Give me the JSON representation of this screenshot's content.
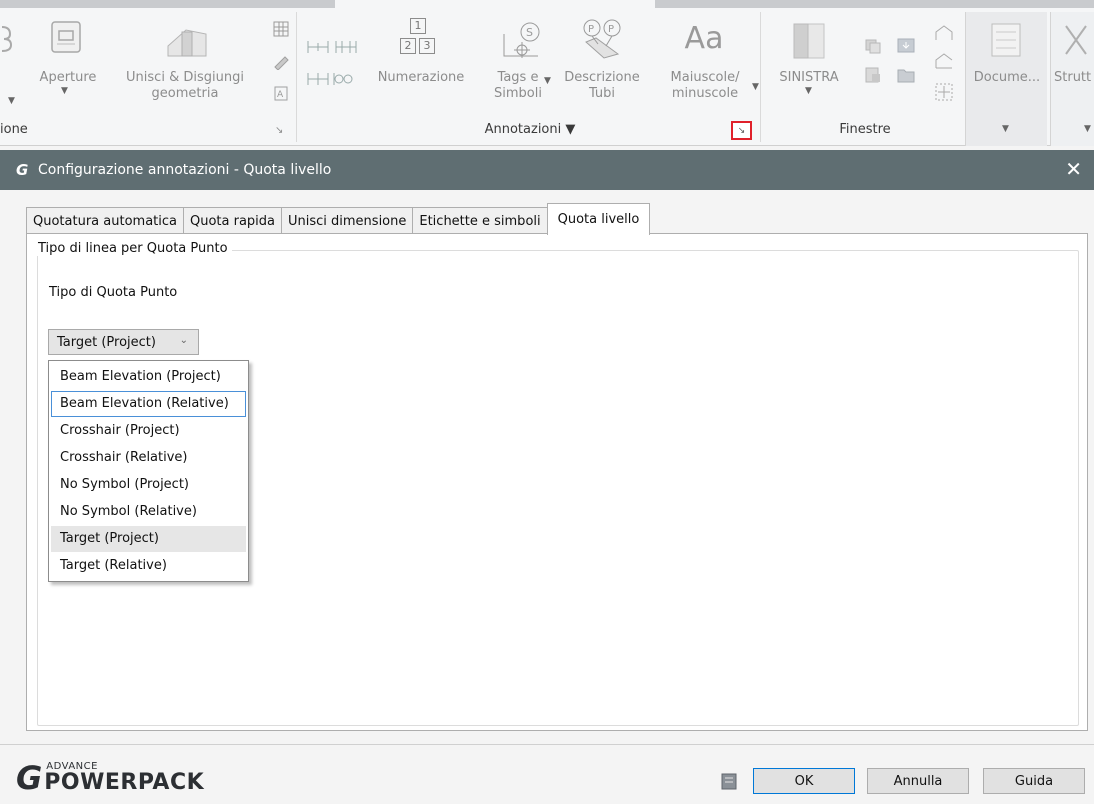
{
  "ribbon": {
    "left_partial_label": "ione",
    "buttons": {
      "aperture": "Aperture",
      "unisci_line1": "Unisci & Disgiungi",
      "unisci_line2": "geometria",
      "numerazione": "Numerazione",
      "tags_line1": "Tags e",
      "tags_line2": "Simboli",
      "descr_line1": "Descrizione",
      "descr_line2": "Tubi",
      "maiusc_glyph": "Aa",
      "maiusc_line1": "Maiuscole/",
      "maiusc_line2": "minuscole",
      "sinistra": "SINISTRA",
      "documenti": "Docume...",
      "strutture": "Strutt"
    },
    "groups": {
      "annotazioni": "Annotazioni ▼",
      "finestre": "Finestre"
    },
    "number_icon": {
      "top": "1",
      "left": "2",
      "right": "3"
    }
  },
  "dialog": {
    "title": "Configurazione annotazioni - Quota livello",
    "close_glyph": "✕",
    "tabs": [
      {
        "label": "Quotatura automatica"
      },
      {
        "label": "Quota rapida"
      },
      {
        "label": "Unisci dimensione"
      },
      {
        "label": "Etichette e simboli"
      },
      {
        "label": "Quota livello"
      }
    ],
    "group_title": "Tipo di linea per Quota Punto",
    "field_label": "Tipo di Quota Punto",
    "select_value": "Target (Project)",
    "options": [
      "Beam Elevation (Project)",
      "Beam Elevation (Relative)",
      "Crosshair (Project)",
      "Crosshair (Relative)",
      "No Symbol (Project)",
      "No Symbol (Relative)",
      "Target (Project)",
      "Target (Relative)"
    ]
  },
  "footer": {
    "brand_small": "ADVANCE",
    "brand_big": "POWERPACK",
    "ok": "OK",
    "cancel": "Annulla",
    "help": "Guida"
  },
  "colors": {
    "titlebar": "#5f6e72",
    "launcher_highlight": "#e0202a",
    "focus_border": "#4a90d8"
  }
}
